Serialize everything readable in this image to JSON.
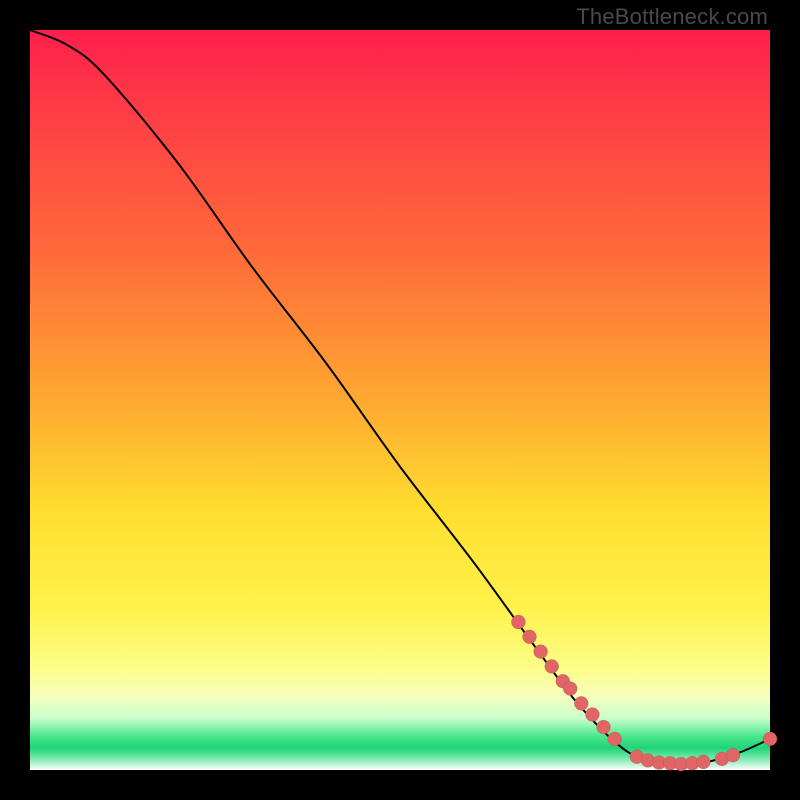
{
  "watermark": "TheBottleneck.com",
  "chart_data": {
    "type": "line",
    "title": "",
    "xlabel": "",
    "ylabel": "",
    "xlim": [
      0,
      100
    ],
    "ylim": [
      0,
      100
    ],
    "curve": [
      {
        "x": 0,
        "y": 100
      },
      {
        "x": 5,
        "y": 98
      },
      {
        "x": 10,
        "y": 94
      },
      {
        "x": 20,
        "y": 82
      },
      {
        "x": 30,
        "y": 68
      },
      {
        "x": 40,
        "y": 55
      },
      {
        "x": 50,
        "y": 41
      },
      {
        "x": 60,
        "y": 28
      },
      {
        "x": 68,
        "y": 17
      },
      {
        "x": 74,
        "y": 9
      },
      {
        "x": 80,
        "y": 3
      },
      {
        "x": 84,
        "y": 1.2
      },
      {
        "x": 88,
        "y": 0.8
      },
      {
        "x": 92,
        "y": 1.2
      },
      {
        "x": 96,
        "y": 2.4
      },
      {
        "x": 100,
        "y": 4.2
      }
    ],
    "points": [
      {
        "x": 66,
        "y": 20
      },
      {
        "x": 67.5,
        "y": 18
      },
      {
        "x": 69,
        "y": 16
      },
      {
        "x": 70.5,
        "y": 14
      },
      {
        "x": 72,
        "y": 12
      },
      {
        "x": 73,
        "y": 11
      },
      {
        "x": 74.5,
        "y": 9
      },
      {
        "x": 76,
        "y": 7.5
      },
      {
        "x": 77.5,
        "y": 5.8
      },
      {
        "x": 79,
        "y": 4.2
      },
      {
        "x": 82,
        "y": 1.8
      },
      {
        "x": 83.5,
        "y": 1.3
      },
      {
        "x": 85,
        "y": 1.0
      },
      {
        "x": 86.5,
        "y": 0.9
      },
      {
        "x": 88,
        "y": 0.8
      },
      {
        "x": 89.5,
        "y": 0.9
      },
      {
        "x": 91,
        "y": 1.1
      },
      {
        "x": 93.5,
        "y": 1.5
      },
      {
        "x": 95,
        "y": 2.0
      },
      {
        "x": 100,
        "y": 4.2
      }
    ]
  }
}
